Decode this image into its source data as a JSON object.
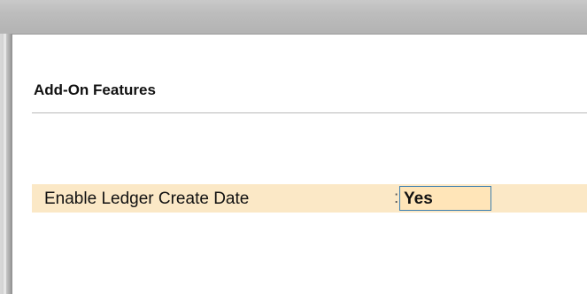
{
  "panel": {
    "title": "Add-On Features"
  },
  "options": [
    {
      "label": "Enable Ledger Create Date",
      "separator": ":",
      "value": "Yes"
    }
  ],
  "colors": {
    "highlight_row": "#fbe8c6",
    "value_field_bg": "#ffe5b8",
    "value_field_border": "#3c7fb1"
  }
}
